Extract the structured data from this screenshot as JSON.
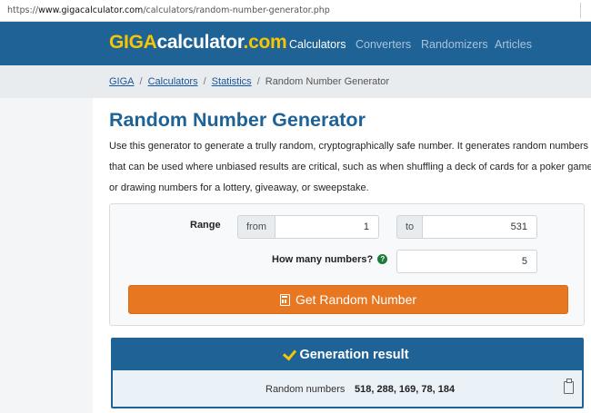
{
  "browser": {
    "url_prefix": "https://",
    "url_host": "www.gigacalculator.com",
    "url_path": "/calculators/random-number-generator.php"
  },
  "header": {
    "logo_giga": "GIGA",
    "logo_calc": "calculator",
    "logo_tld": ".com",
    "nav": [
      "Calculators",
      "Converters",
      "Randomizers",
      "Articles"
    ],
    "active_nav": "Calculators"
  },
  "breadcrumb": {
    "items": [
      "GIGA",
      "Calculators",
      "Statistics"
    ],
    "current": "Random Number Generator",
    "separator": "/"
  },
  "page": {
    "title": "Random Number Generator",
    "intro": "Use this generator to generate a trully random, cryptographically safe number. It generates random numbers that can be used where unbiased results are critical, such as when shuffling a deck of cards for a poker game or drawing numbers for a lottery, giveaway, or sweepstake."
  },
  "form": {
    "range_label": "Range",
    "from_label": "from",
    "from_value": "1",
    "to_label": "to",
    "to_value": "531",
    "count_label": "How many numbers?",
    "help_icon": "question-circle-icon",
    "count_value": "5",
    "submit_label": "Get Random Number",
    "submit_icon": "calculator-icon"
  },
  "result": {
    "heading": "Generation result",
    "label": "Random numbers",
    "value": "518, 288, 169, 78, 184"
  },
  "colors": {
    "brand_blue": "#1e6296",
    "logo_yellow": "#f7c600",
    "button_orange": "#e87722",
    "help_green": "#1d7a3a"
  }
}
